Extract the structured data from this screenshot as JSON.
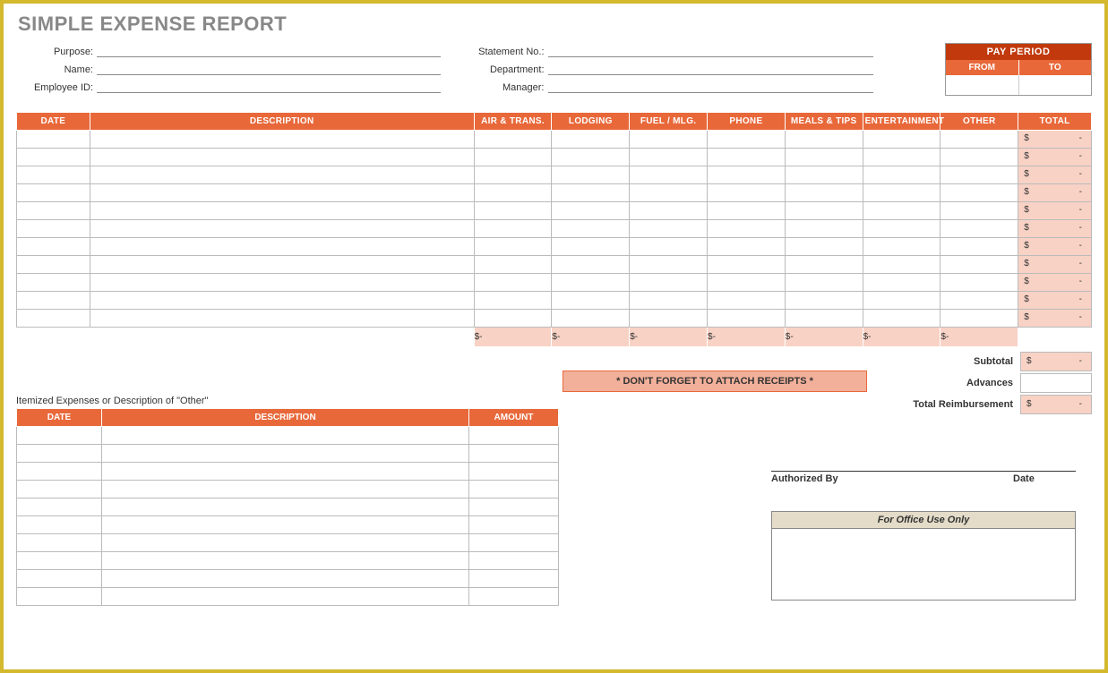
{
  "title": "SIMPLE EXPENSE REPORT",
  "header": {
    "left": [
      {
        "label": "Purpose:",
        "value": ""
      },
      {
        "label": "Name:",
        "value": ""
      },
      {
        "label": "Employee ID:",
        "value": ""
      }
    ],
    "right": [
      {
        "label": "Statement No.:",
        "value": ""
      },
      {
        "label": "Department:",
        "value": ""
      },
      {
        "label": "Manager:",
        "value": ""
      }
    ]
  },
  "pay_period": {
    "title": "PAY PERIOD",
    "from_label": "FROM",
    "to_label": "TO",
    "from": "",
    "to": ""
  },
  "expense_table": {
    "columns": [
      "DATE",
      "DESCRIPTION",
      "AIR & TRANS.",
      "LODGING",
      "FUEL / MLG.",
      "PHONE",
      "MEALS & TIPS",
      "ENTERTAINMENT",
      "OTHER",
      "TOTAL"
    ],
    "row_count": 11,
    "currency": "$",
    "empty_marker": "-",
    "subtotal_row_currency": "$",
    "subtotal_row_marker": "-"
  },
  "summary": {
    "subtotal_label": "Subtotal",
    "subtotal_currency": "$",
    "subtotal_value": "-",
    "advances_label": "Advances",
    "advances_value": "",
    "total_label": "Total Reimbursement",
    "total_currency": "$",
    "total_value": "-"
  },
  "reminder": "* DON'T FORGET TO ATTACH RECEIPTS *",
  "itemized": {
    "title": "Itemized Expenses or Description of \"Other\"",
    "columns": [
      "DATE",
      "DESCRIPTION",
      "AMOUNT"
    ],
    "row_count": 10
  },
  "signature": {
    "authorized_label": "Authorized By",
    "date_label": "Date"
  },
  "office_use": {
    "title": "For Office Use Only"
  }
}
